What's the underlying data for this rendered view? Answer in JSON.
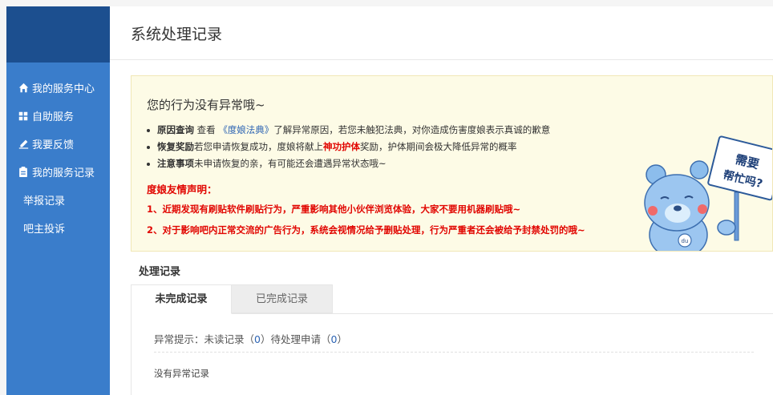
{
  "sidebar": {
    "items": [
      {
        "label": "我的服务中心",
        "icon": "home-icon"
      },
      {
        "label": "自助服务",
        "icon": "grid-icon"
      },
      {
        "label": "我要反馈",
        "icon": "edit-icon"
      },
      {
        "label": "我的服务记录",
        "icon": "clipboard-icon"
      },
      {
        "label": "举报记录"
      },
      {
        "label": "吧主投诉"
      }
    ]
  },
  "header": {
    "title": "系统处理记录"
  },
  "notice": {
    "title": "您的行为没有异常哦~",
    "bullets": [
      {
        "head": "原因查询",
        "pre": " 查看 ",
        "link": "《度娘法典》",
        "post": "了解异常原因，若您未触犯法典，对你造成伤害度娘表示真诚的歉意"
      },
      {
        "head": "恢复奖励",
        "pre": "若您申请恢复成功，度娘将献上",
        "red": "神功护体",
        "post": "奖励，护体期间会极大降低异常的概率"
      },
      {
        "head": "注意事项",
        "post": "未申请恢复的亲，有可能还会遭遇异常状态哦~"
      }
    ],
    "declaration_title": "度娘友情声明：",
    "declarations": [
      "1、近期发现有刷贴软件刷贴行为，严重影响其他小伙伴浏览体验，大家不要用机器刷贴哦~",
      "2、对于影响吧内正常交流的广告行为，系统会视情况给予删贴处理，行为严重者还会被给予封禁处罚的哦~"
    ],
    "help_sign": [
      "需要",
      "帮忙吗?"
    ]
  },
  "records": {
    "section_label": "处理记录",
    "tabs": [
      {
        "label": "未完成记录",
        "active": true
      },
      {
        "label": "已完成记录",
        "active": false
      }
    ],
    "stats": {
      "prefix": "异常提示：未读记录（",
      "unread": "0",
      "middle": "）待处理申请（",
      "pending": "0",
      "suffix": "）"
    },
    "empty_text": "没有异常记录"
  },
  "colors": {
    "sidebar_bg": "#3a7dcb",
    "sidebar_top": "#1c4f8f",
    "notice_bg": "#fdfbe6",
    "alert_red": "#e10601",
    "link_blue": "#2d64b3"
  }
}
